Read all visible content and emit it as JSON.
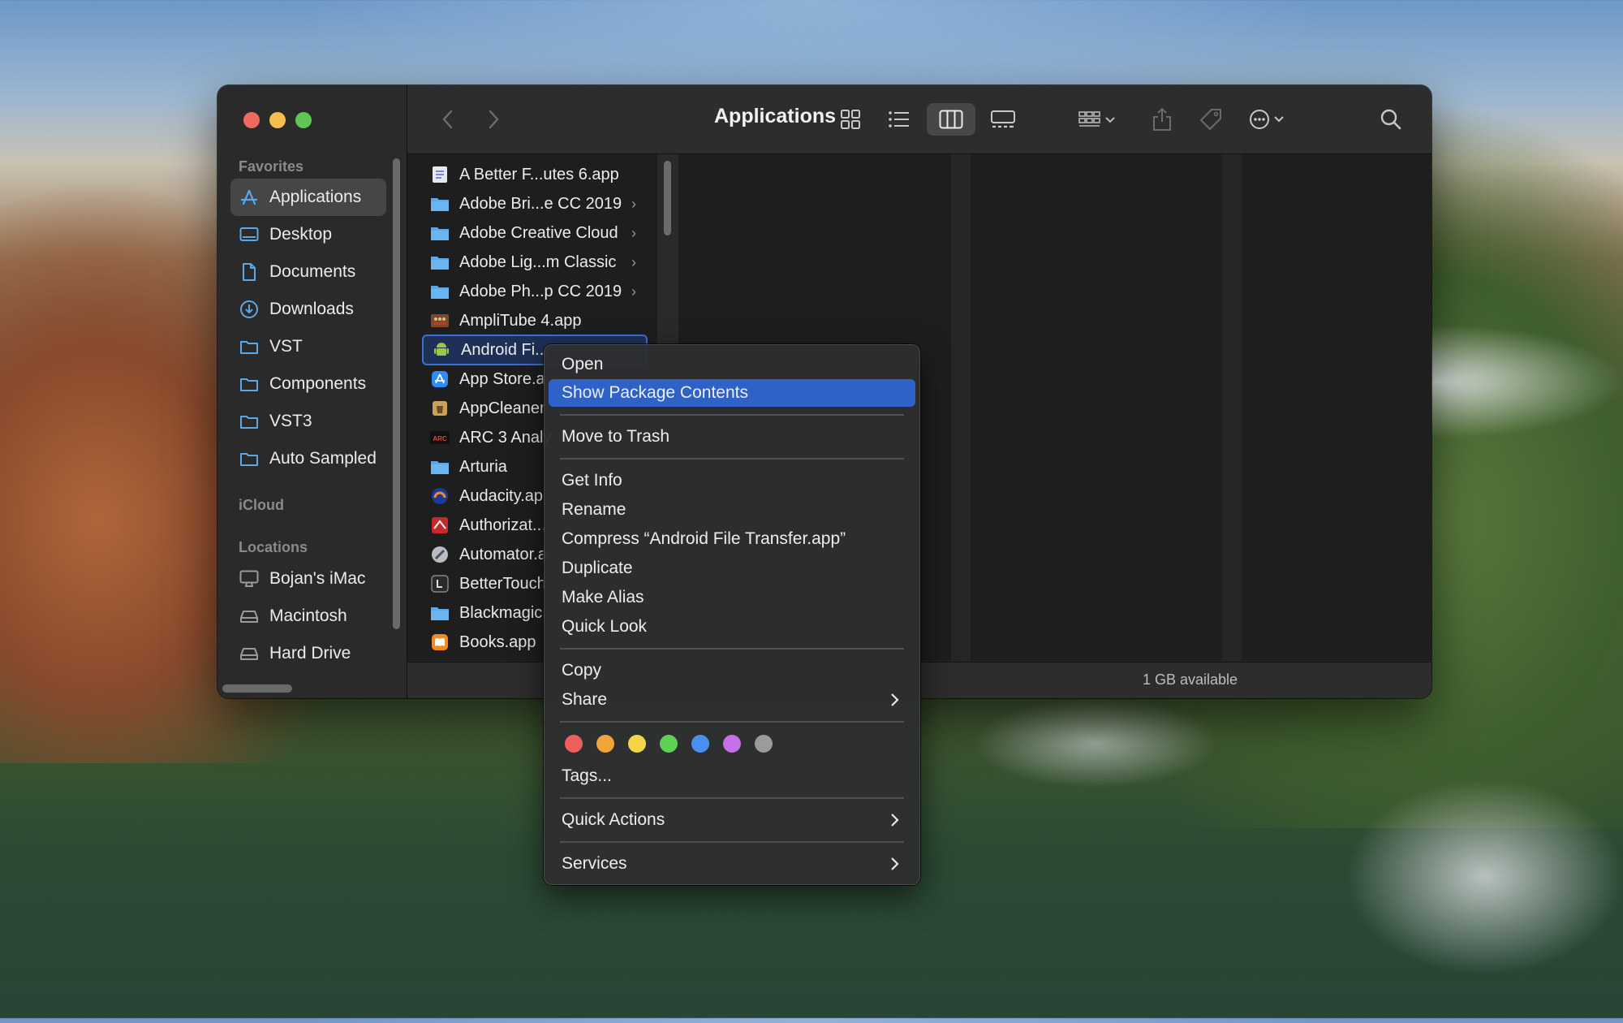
{
  "sidebar": {
    "headings": {
      "favorites": "Favorites",
      "icloud": "iCloud",
      "locations": "Locations"
    },
    "favorites": [
      {
        "label": "Applications",
        "icon": "applications-icon"
      },
      {
        "label": "Desktop",
        "icon": "desktop-icon"
      },
      {
        "label": "Documents",
        "icon": "document-icon"
      },
      {
        "label": "Downloads",
        "icon": "downloads-icon"
      },
      {
        "label": "VST",
        "icon": "folder-icon"
      },
      {
        "label": "Components",
        "icon": "folder-icon"
      },
      {
        "label": "VST3",
        "icon": "folder-icon"
      },
      {
        "label": "Auto Sampled",
        "icon": "folder-icon"
      }
    ],
    "locations": [
      {
        "label": "Bojan's iMac",
        "icon": "imac-icon"
      },
      {
        "label": "Macintosh",
        "icon": "drive-icon"
      },
      {
        "label": "Hard Drive",
        "icon": "drive-icon"
      }
    ]
  },
  "toolbar": {
    "title": "Applications"
  },
  "files": [
    {
      "label": "A Better F...utes 6.app"
    },
    {
      "label": "Adobe Bri...e CC 2019"
    },
    {
      "label": "Adobe Creative Cloud"
    },
    {
      "label": "Adobe Lig...m Classic"
    },
    {
      "label": "Adobe Ph...p CC 2019"
    },
    {
      "label": "AmpliTube 4.app"
    },
    {
      "label": "Android Fi..."
    },
    {
      "label": "App Store.a"
    },
    {
      "label": "AppCleaner"
    },
    {
      "label": "ARC 3 Analy"
    },
    {
      "label": "Arturia"
    },
    {
      "label": "Audacity.ap"
    },
    {
      "label": "Authorizat..."
    },
    {
      "label": "Automator.a"
    },
    {
      "label": "BetterTouch"
    },
    {
      "label": "Blackmagic"
    },
    {
      "label": "Books.app"
    }
  ],
  "status": {
    "text": "1 GB available"
  },
  "menu": {
    "open": "Open",
    "show_package": "Show Package Contents",
    "trash": "Move to Trash",
    "get_info": "Get Info",
    "rename": "Rename",
    "compress": "Compress “Android File Transfer.app”",
    "duplicate": "Duplicate",
    "make_alias": "Make Alias",
    "quick_look": "Quick Look",
    "copy": "Copy",
    "share": "Share",
    "tags": "Tags...",
    "quick_actions": "Quick Actions",
    "services": "Services"
  },
  "tag_colors": [
    "#ec5f5c",
    "#f0a43a",
    "#f5d547",
    "#5fcf55",
    "#4a8fef",
    "#c470e6",
    "#9b9b9d"
  ],
  "colors": {
    "accent": "#2f62c8",
    "selection_border": "#3b6fd6",
    "folder": "#5aa8e8"
  }
}
